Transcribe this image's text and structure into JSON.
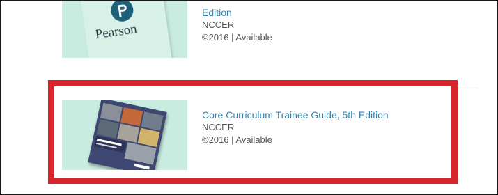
{
  "results": [
    {
      "title": "Edition",
      "author": "NCCER",
      "meta": "©2016 | Available",
      "cover_text": "Pearson"
    },
    {
      "title": "Core Curriculum Trainee Guide, 5th Edition",
      "author": "NCCER",
      "meta": "©2016 | Available",
      "cover_text": "Core Curriculum: Introductory Craft Skills"
    }
  ],
  "colors": {
    "link": "#2f86b5",
    "highlight": "#d8262f",
    "thumb_bg": "#c9ece1"
  }
}
